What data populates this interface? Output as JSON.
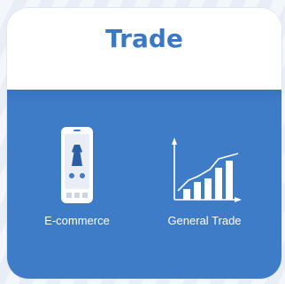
{
  "card": {
    "title": "Trade",
    "items": [
      {
        "label": "E-commerce",
        "icon": "smartphone-dress-icon"
      },
      {
        "label": "General Trade",
        "icon": "growth-chart-icon"
      }
    ]
  },
  "colors": {
    "title": "#3b78c4",
    "panel": "#3f7cc8",
    "card": "#ffffff"
  }
}
